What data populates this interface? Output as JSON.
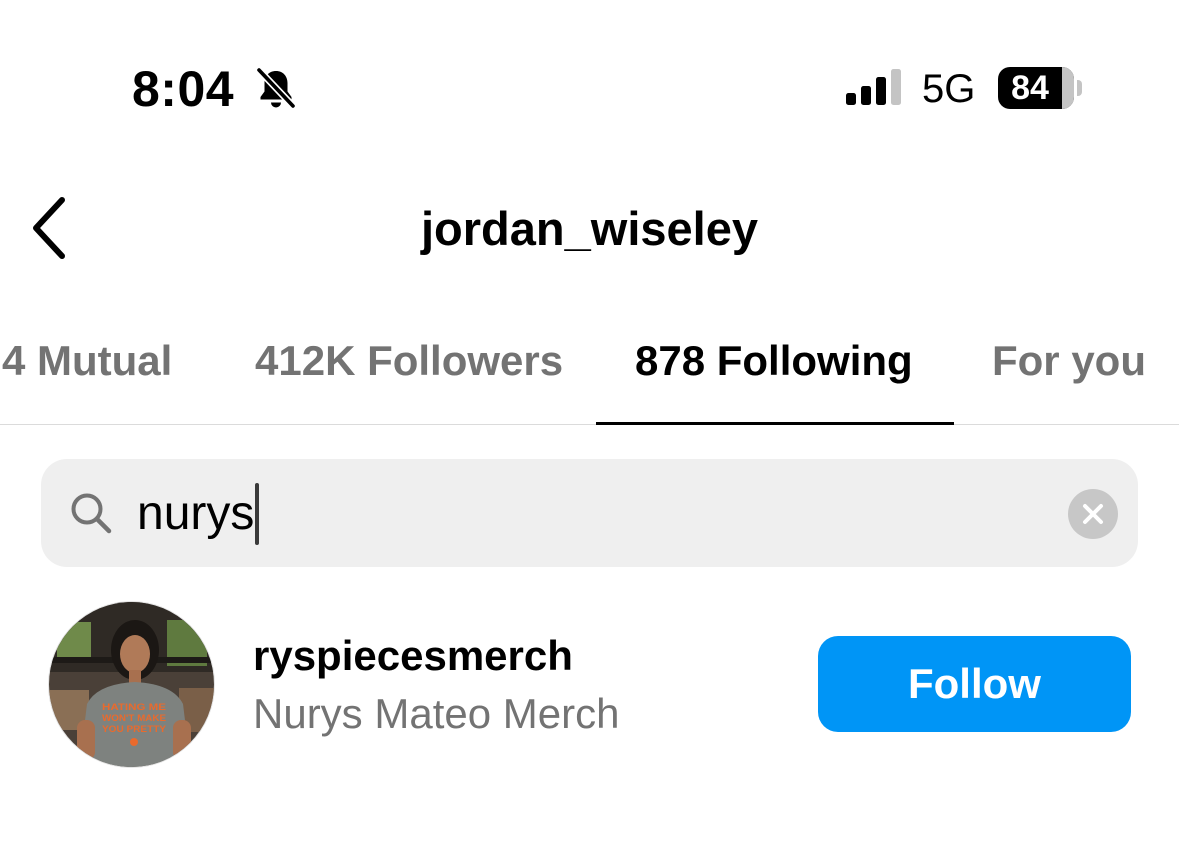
{
  "status_bar": {
    "time": "8:04",
    "network": "5G",
    "battery_level": "84",
    "icons": [
      "bell-slash-icon",
      "cellular-signal-icon",
      "battery-icon"
    ]
  },
  "header": {
    "title": "jordan_wiseley",
    "back_icon": "chevron-left-icon"
  },
  "tabs": [
    {
      "label": "4 Mutual",
      "active": false
    },
    {
      "label": "412K Followers",
      "active": false
    },
    {
      "label": "878 Following",
      "active": true
    },
    {
      "label": "For you",
      "active": false
    }
  ],
  "search": {
    "value": "nurys",
    "icon": "search-icon",
    "clear_icon": "clear-icon"
  },
  "results": [
    {
      "username": "ryspiecesmerch",
      "full_name": "Nurys Mateo Merch",
      "avatar_shirt_text": "HATING ME WON'T MAKE YOU PRETTY",
      "action_label": "Follow"
    }
  ],
  "colors": {
    "accent": "#0095f6",
    "secondary_text": "#737373",
    "search_bg": "#efefef"
  }
}
